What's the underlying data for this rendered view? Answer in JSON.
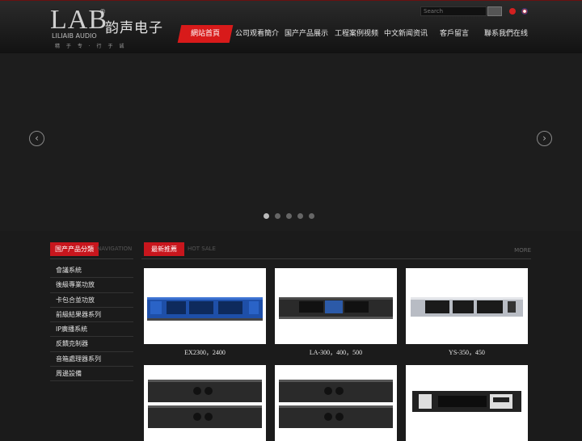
{
  "header": {
    "logo_text": "LAB",
    "logo_registered": "®",
    "logo_cn": "韵声电子",
    "logo_sub": "LILIAIB AUDIO",
    "logo_slogan": "精 于 专 · 行 于 诚",
    "search_placeholder": "Search",
    "lang_cn_icon": "china-flag-icon",
    "lang_en_icon": "uk-flag-icon"
  },
  "nav": {
    "items": [
      {
        "label": "網站首頁",
        "active": true
      },
      {
        "label": "公司观看簡介"
      },
      {
        "label": "国产产品展示"
      },
      {
        "label": "工程案例视频"
      },
      {
        "label": "中文新闻资讯"
      },
      {
        "label": "客戶留言"
      },
      {
        "label": "聯系我們在线"
      }
    ]
  },
  "slider": {
    "prev_icon": "chevron-left-icon",
    "next_icon": "chevron-right-icon",
    "dots": 5,
    "active_dot": 0
  },
  "sidebar": {
    "title": "国产产品分類",
    "title_en": "NAVIGATION",
    "items": [
      "會議系統",
      "後級專業功放",
      "卡包合並功放",
      "前級結果器系列",
      "IP廣播系統",
      "反饋克制器",
      "音箱處理器系列",
      "周邊設備"
    ]
  },
  "products": {
    "title": "最新推薦",
    "title_en": "HOT SALE",
    "more": "MORE",
    "items": [
      {
        "caption": "EX2300，2400"
      },
      {
        "caption": "LA-300，400，500"
      },
      {
        "caption": "YS-350，450"
      },
      {
        "caption": ""
      },
      {
        "caption": ""
      },
      {
        "caption": ""
      }
    ]
  },
  "colors": {
    "accent": "#d81a1a",
    "background": "#1b1b1b",
    "header": "#1e1e1e"
  }
}
